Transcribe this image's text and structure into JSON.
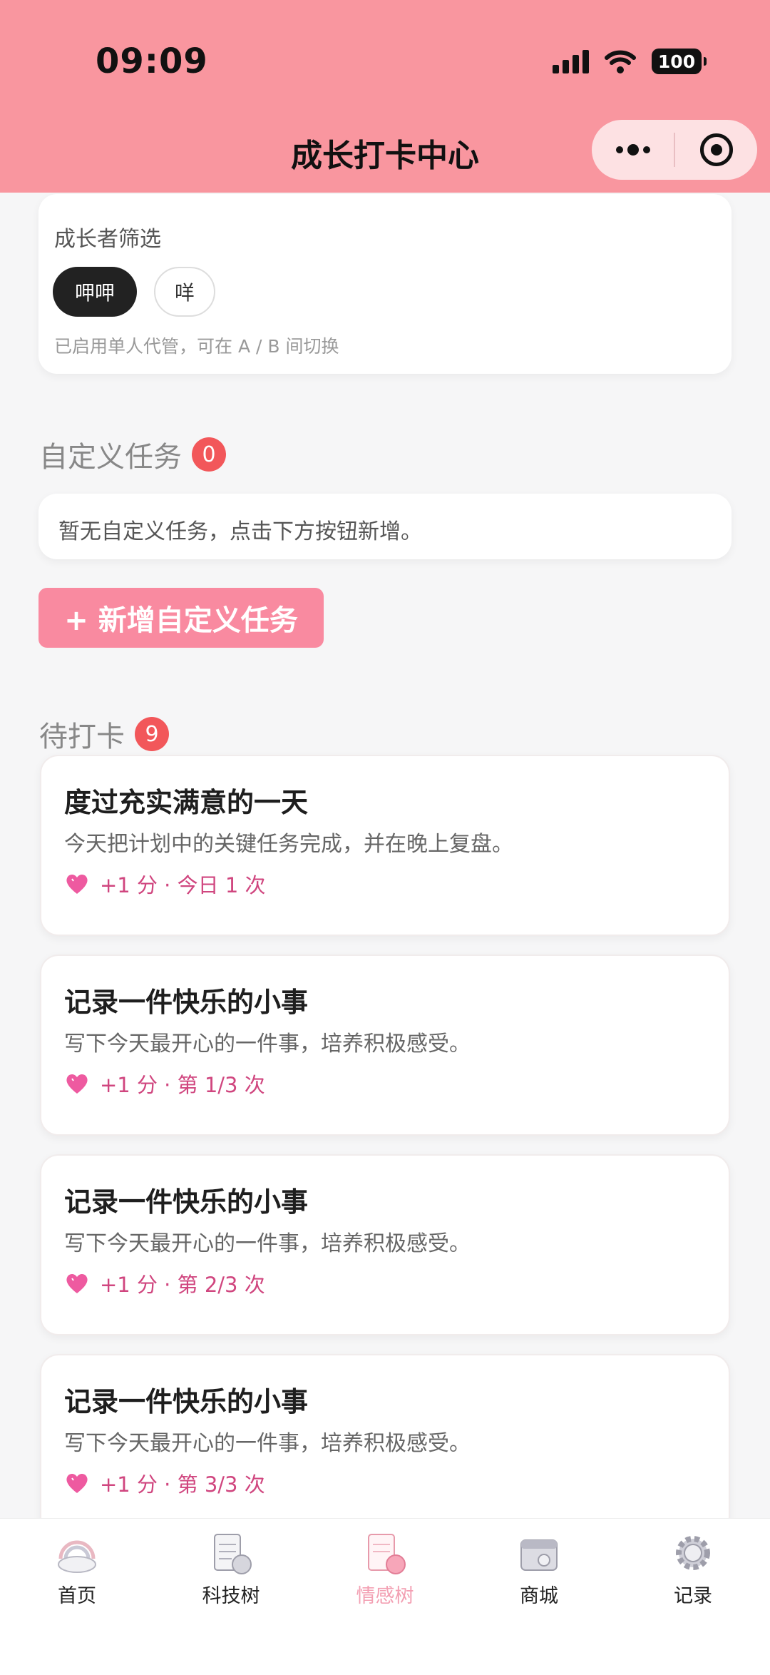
{
  "status_bar": {
    "time": "09:09",
    "battery": "100"
  },
  "header": {
    "title": "成长打卡中心"
  },
  "filter": {
    "title": "成长者筛选",
    "chips": [
      "呷呷",
      "咩"
    ],
    "hint": "已启用单人代管，可在 A / B 间切换"
  },
  "custom_tasks": {
    "title": "自定义任务",
    "count": "0",
    "empty_text": "暂无自定义任务，点击下方按钮新增。",
    "add_button": "+ 新增自定义任务"
  },
  "pending": {
    "title": "待打卡",
    "count": "9",
    "tasks": [
      {
        "title": "度过充实满意的一天",
        "desc": "今天把计划中的关键任务完成，并在晚上复盘。",
        "meta": "+1 分 · 今日 1 次"
      },
      {
        "title": "记录一件快乐的小事",
        "desc": "写下今天最开心的一件事，培养积极感受。",
        "meta": "+1 分 · 第 1/3 次"
      },
      {
        "title": "记录一件快乐的小事",
        "desc": "写下今天最开心的一件事，培养积极感受。",
        "meta": "+1 分 · 第 2/3 次"
      },
      {
        "title": "记录一件快乐的小事",
        "desc": "写下今天最开心的一件事，培养积极感受。",
        "meta": "+1 分 · 第 3/3 次"
      }
    ]
  },
  "tabbar": {
    "items": [
      {
        "label": "首页",
        "icon": "rainbow-cloud-icon"
      },
      {
        "label": "科技树",
        "icon": "notepad-icon"
      },
      {
        "label": "情感树",
        "icon": "heart-notepad-icon"
      },
      {
        "label": "商城",
        "icon": "shop-icon"
      },
      {
        "label": "记录",
        "icon": "gear-icon"
      }
    ],
    "active_index": 2
  },
  "colors": {
    "header": "#f9969f",
    "accent": "#f98aa0",
    "badge": "#f2575a",
    "meta": "#d0467f"
  }
}
